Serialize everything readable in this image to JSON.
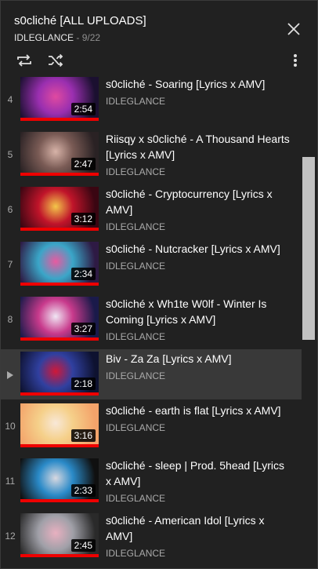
{
  "playlist": {
    "title": "s0cliché [ALL UPLOADS]",
    "owner": "IDLEGLANCE",
    "separator": " - ",
    "position": "9/22"
  },
  "icons": {
    "close": "close-icon",
    "loop": "loop-icon",
    "shuffle": "shuffle-icon",
    "menu": "more-vert-icon",
    "now_playing": "play-arrow-icon"
  },
  "colors": {
    "background": "#212121",
    "active_row": "#393939",
    "progress_red": "#ee0000",
    "secondary_text": "#aaaaaa"
  },
  "videos": [
    {
      "index": "4",
      "title": "s0cliché - Soaring [Lyrics x AMV]",
      "duration": "2:54",
      "channel": "IDLEGLANCE",
      "active": false,
      "art": [
        "#1b1030",
        "#9a2fb0",
        "#e04aa0"
      ]
    },
    {
      "index": "5",
      "title": "Riisqy x s0cliché - A Thousand Hearts [Lyrics x AMV]",
      "duration": "2:47",
      "channel": "IDLEGLANCE",
      "active": false,
      "art": [
        "#2a2224",
        "#7a5b55",
        "#d7b3a8"
      ]
    },
    {
      "index": "6",
      "title": "s0cliché - Cryptocurrency [Lyrics x AMV]",
      "duration": "3:12",
      "channel": "IDLEGLANCE",
      "active": false,
      "art": [
        "#3a0612",
        "#c0142a",
        "#f3c64a"
      ]
    },
    {
      "index": "7",
      "title": "s0cliché - Nutcracker [Lyrics x AMV]",
      "duration": "2:34",
      "channel": "IDLEGLANCE",
      "active": false,
      "art": [
        "#2e1a44",
        "#3aa6c8",
        "#e85aa0"
      ]
    },
    {
      "index": "8",
      "title": "s0cliché x Wh1te W0lf - Winter Is Coming [Lyrics x AMV]",
      "duration": "3:27",
      "channel": "IDLEGLANCE",
      "active": false,
      "art": [
        "#1a1a4a",
        "#c83a8c",
        "#f0e6f4"
      ]
    },
    {
      "index": "",
      "title": "Biv - Za Za [Lyrics x AMV]",
      "duration": "2:18",
      "channel": "IDLEGLANCE",
      "active": true,
      "art": [
        "#0e1230",
        "#3040a0",
        "#d01838"
      ]
    },
    {
      "index": "10",
      "title": "s0cliché - earth is flat [Lyrics x AMV]",
      "duration": "3:16",
      "channel": "IDLEGLANCE",
      "active": false,
      "art": [
        "#f3a36a",
        "#f5d08a",
        "#f8e8d8"
      ]
    },
    {
      "index": "11",
      "title": "s0cliché - sleep | Prod. 5head [Lyrics x AMV]",
      "duration": "2:33",
      "channel": "IDLEGLANCE",
      "active": false,
      "art": [
        "#101010",
        "#2a8ac8",
        "#d8d8e0"
      ]
    },
    {
      "index": "12",
      "title": "s0cliché - American Idol [Lyrics x AMV]",
      "duration": "2:45",
      "channel": "IDLEGLANCE",
      "active": false,
      "art": [
        "#2a2a2a",
        "#a0a0a8",
        "#e8b0c0"
      ]
    }
  ]
}
